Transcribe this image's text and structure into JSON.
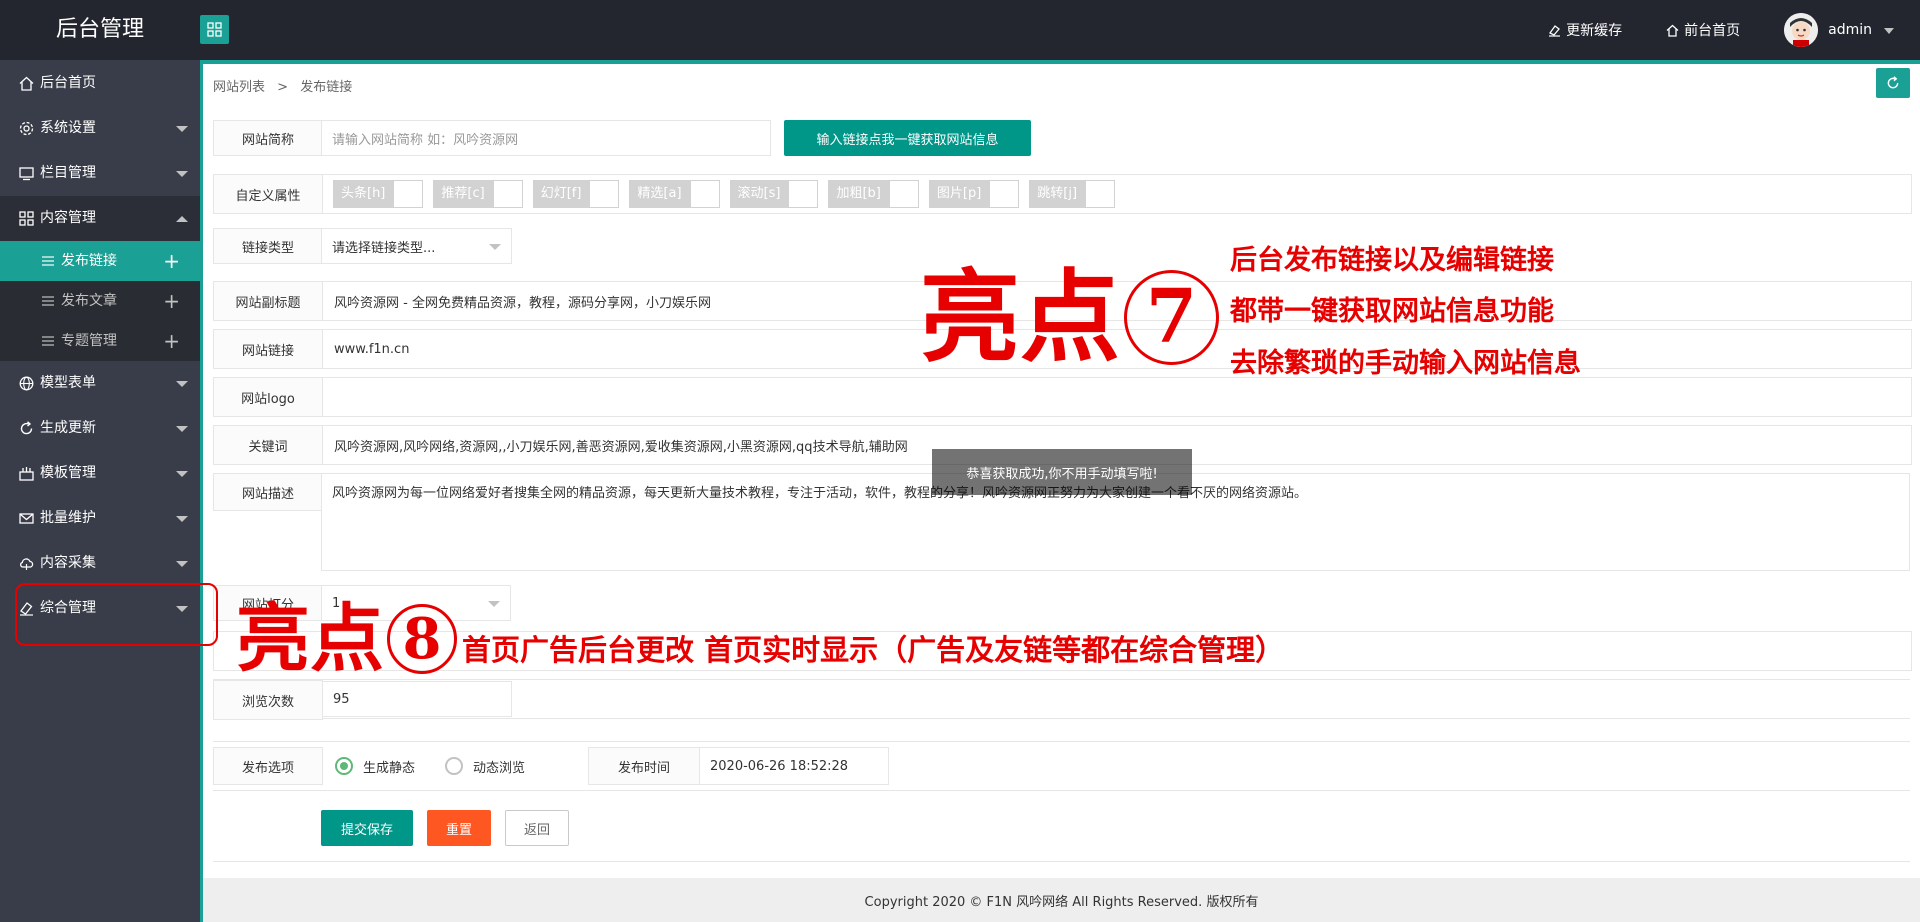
{
  "header": {
    "logo": "后台管理",
    "update_cache": "更新缓存",
    "front_home": "前台首页",
    "username": "admin"
  },
  "sidebar": {
    "items": [
      {
        "label": "后台首页",
        "icon": "home-icon"
      },
      {
        "label": "系统设置",
        "icon": "gear-icon"
      },
      {
        "label": "栏目管理",
        "icon": "monitor-icon"
      },
      {
        "label": "内容管理",
        "icon": "grid-icon"
      },
      {
        "label": "模型表单",
        "icon": "globe-icon"
      },
      {
        "label": "生成更新",
        "icon": "refresh-icon"
      },
      {
        "label": "模板管理",
        "icon": "template-icon"
      },
      {
        "label": "批量维护",
        "icon": "mail-icon"
      },
      {
        "label": "内容采集",
        "icon": "cloud-icon"
      },
      {
        "label": "综合管理",
        "icon": "eraser-icon"
      }
    ],
    "sub_items": [
      {
        "label": "发布链接",
        "active": true
      },
      {
        "label": "发布文章",
        "active": false
      },
      {
        "label": "专题管理",
        "active": false
      }
    ]
  },
  "breadcrumb": {
    "parent": "网站列表",
    "separator": ">",
    "current": "发布链接"
  },
  "form": {
    "site_name_label": "网站简称",
    "site_name_placeholder": "请输入网站简称 如：风吟资源网",
    "fetch_button": "输入链接点我一键获取网站信息",
    "custom_attr_label": "自定义属性",
    "attrs": [
      "头条[h]",
      "推荐[c]",
      "幻灯[f]",
      "精选[a]",
      "滚动[s]",
      "加粗[b]",
      "图片[p]",
      "跳转[j]"
    ],
    "link_type_label": "链接类型",
    "link_type_value": "请选择链接类型...",
    "subtitle_label": "网站副标题",
    "subtitle_value": "风吟资源网 - 全网免费精品资源，教程，源码分享网，小刀娱乐网",
    "link_label": "网站链接",
    "link_value": "www.f1n.cn",
    "logo_label": "网站logo",
    "keywords_label": "关键词",
    "keywords_value": "风吟资源网,风吟网络,资源网,,小刀娱乐网,善恶资源网,爱收集资源网,小黑资源网,qq技术导航,辅助网",
    "desc_label": "网站描述",
    "desc_value": "风吟资源网为每一位网络爱好者搜集全网的精品资源，每天更新大量技术教程，专注于活动，软件，教程的分享！风吟资源网正努力为大家创建一个看不厌的网络资源站。",
    "score_label": "网站打分",
    "score_value": "1",
    "views_label": "浏览次数",
    "views_value": "95",
    "publish_label": "发布选项",
    "radio_static": "生成静态",
    "radio_dynamic": "动态浏览",
    "publish_time_label": "发布时间",
    "publish_time_value": "2020-06-26 18:52:28",
    "submit": "提交保存",
    "reset": "重置",
    "back": "返回"
  },
  "tooltip": "恭喜获取成功,你不用手动填写啦!",
  "footer": "Copyright 2020 © F1N 风吟网络 All Rights Reserved. 版权所有",
  "annotations": {
    "seven_title": "亮点",
    "seven_num": "7",
    "seven_lines": [
      "后台发布链接以及编辑链接",
      "都带一键获取网站信息功能",
      "去除繁琐的手动输入网站信息"
    ],
    "eight_title": "亮点",
    "eight_num": "8",
    "eight_text": "首页广告后台更改 首页实时显示（广告及友链等都在综合管理）"
  },
  "colors": {
    "accent": "#1aa094",
    "sidebar_bg": "#393d49",
    "header_bg": "#23262e",
    "annotation": "#e60000"
  }
}
